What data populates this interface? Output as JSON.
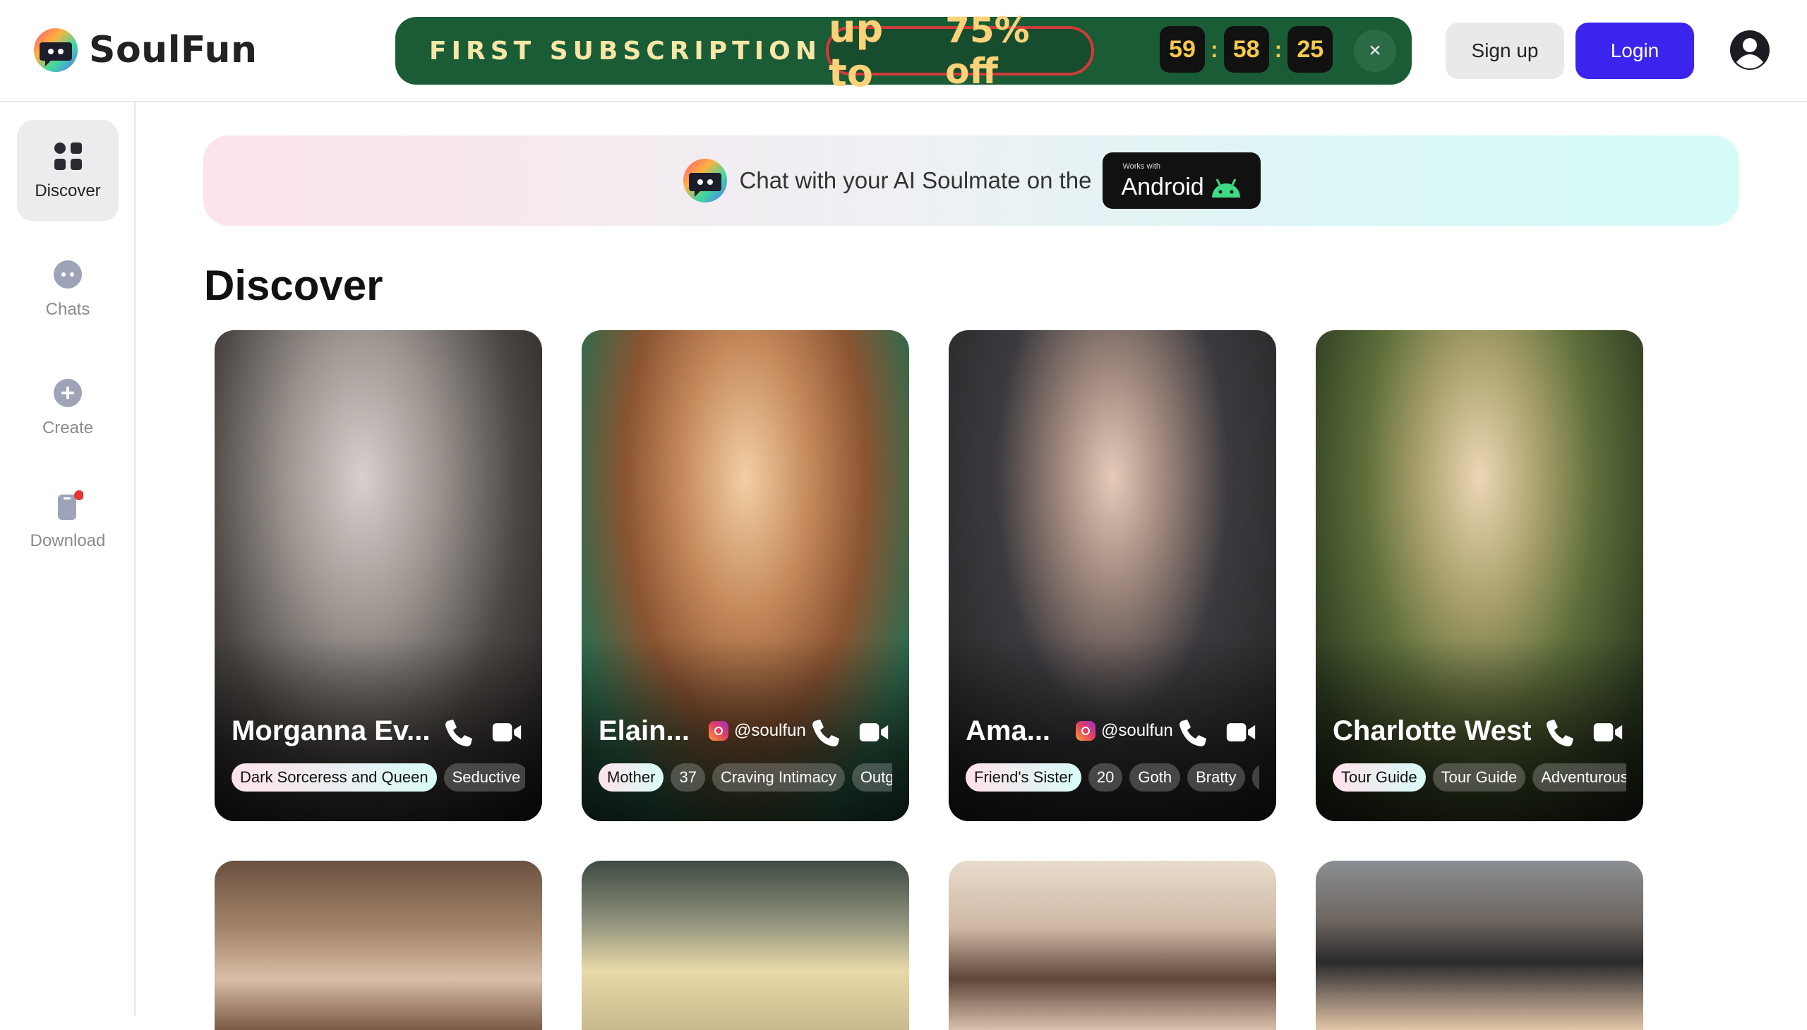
{
  "app": {
    "name": "SoulFun"
  },
  "promo": {
    "title": "FIRST SUBSCRIPTION",
    "offer_prefix": "up to",
    "offer_value": "75% off",
    "countdown": {
      "hours": "59",
      "minutes": "58",
      "seconds": "25",
      "separator": ":"
    },
    "close_label": "×"
  },
  "header": {
    "signup_label": "Sign up",
    "login_label": "Login"
  },
  "sidebar": {
    "items": [
      {
        "label": "Discover",
        "icon": "grid-icon",
        "active": true
      },
      {
        "label": "Chats",
        "icon": "chat-bubble-icon",
        "active": false
      },
      {
        "label": "Create",
        "icon": "plus-circle-icon",
        "active": false
      },
      {
        "label": "Download",
        "icon": "phone-download-icon",
        "active": false,
        "badge_color": "#e53935"
      }
    ]
  },
  "banner": {
    "text": "Chat with your AI Soulmate on the",
    "badge_small": "Works with",
    "badge_word": "Android"
  },
  "main": {
    "title": "Discover"
  },
  "cards": [
    {
      "name": "Morganna Ev...",
      "handle": "",
      "tags": [
        "Dark Sorceress and Queen",
        "Seductive"
      ]
    },
    {
      "name": "Elain...",
      "handle": "@soulfun",
      "tags": [
        "Mother",
        "37",
        "Craving Intimacy",
        "Outgo"
      ]
    },
    {
      "name": "Ama...",
      "handle": "@soulfun",
      "tags": [
        "Friend's Sister",
        "20",
        "Goth",
        "Bratty",
        "D"
      ]
    },
    {
      "name": "Charlotte West",
      "handle": "",
      "tags": [
        "Tour Guide",
        "Tour Guide",
        "Adventurous"
      ]
    }
  ],
  "colors": {
    "promo_bg": "#195c36",
    "promo_text": "#f7e6a6",
    "countdown_digits": "#f6c94c",
    "login_bg": "#3a24ee",
    "signup_bg": "#e9e9ec"
  }
}
